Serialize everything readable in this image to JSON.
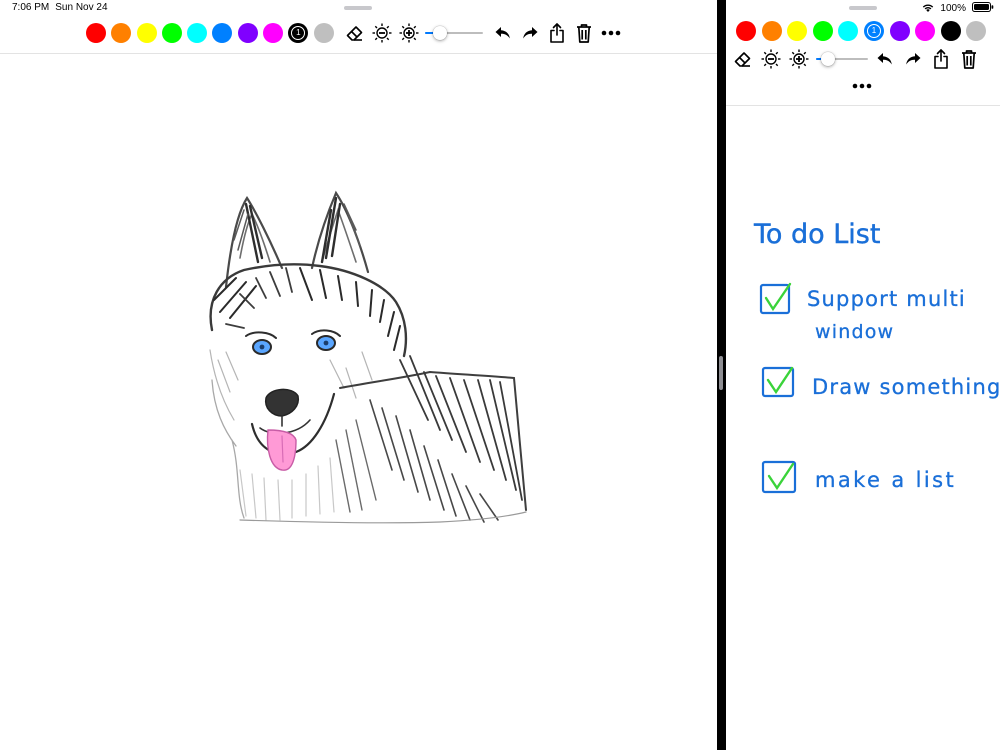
{
  "status_bar": {
    "time": "7:06 PM",
    "date": "Sun Nov 24",
    "battery_percent": "100%"
  },
  "colors": {
    "palette": [
      "#ff0000",
      "#ff8000",
      "#ffff00",
      "#00ff00",
      "#00ffff",
      "#0080ff",
      "#8000ff",
      "#ff00ff",
      "#000000",
      "#bfbfbf"
    ],
    "ink_blue": "#1a6fd8",
    "check_green": "#3ad33a",
    "tongue_pink": "#ff9ad6",
    "eye_blue": "#5aa6ff"
  },
  "left_window": {
    "toolbar": {
      "selected_color_index": 8,
      "selected_size_label": "1",
      "brush_size_level": 0.2,
      "icons": [
        "eraser-icon",
        "brightness-decrease-icon",
        "brightness-increase-icon",
        "undo-icon",
        "redo-icon",
        "share-icon",
        "trash-icon",
        "more-icon"
      ]
    }
  },
  "right_window": {
    "toolbar": {
      "selected_color_index": 5,
      "selected_size_label": "1",
      "brush_size_level": 0.12
    },
    "todo": {
      "title": "To do List",
      "items": [
        {
          "text": "Support multi window",
          "checked": true
        },
        {
          "text": "Draw something",
          "checked": true
        },
        {
          "text": "make a list",
          "checked": true
        }
      ]
    }
  }
}
